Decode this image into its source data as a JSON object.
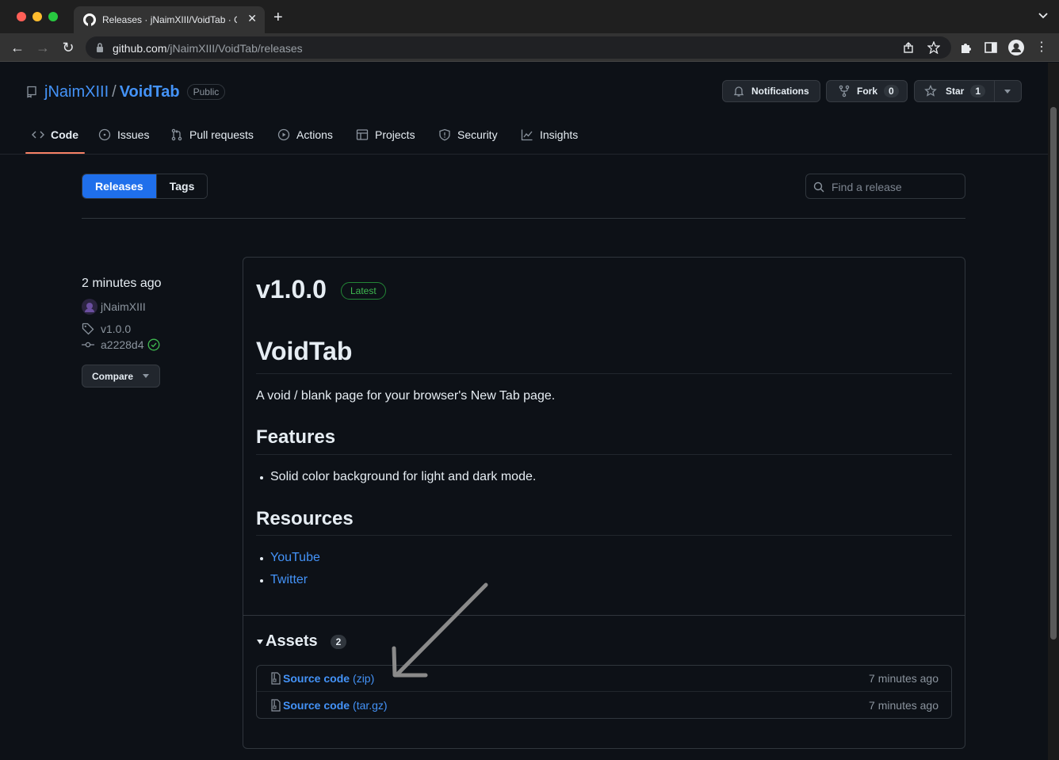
{
  "browser": {
    "tab_title": "Releases · jNaimXIII/VoidTab · GitHub",
    "url_domain": "github.com",
    "url_path": "/jNaimXIII/VoidTab/releases"
  },
  "repo": {
    "owner": "jNaimXIII",
    "separator": "/",
    "name": "VoidTab",
    "visibility": "Public",
    "notifications_label": "Notifications",
    "fork_label": "Fork",
    "fork_count": "0",
    "star_label": "Star",
    "star_count": "1"
  },
  "nav": {
    "items": [
      {
        "label": "Code",
        "icon": "code-icon"
      },
      {
        "label": "Issues",
        "icon": "issue-icon"
      },
      {
        "label": "Pull requests",
        "icon": "pull-request-icon"
      },
      {
        "label": "Actions",
        "icon": "play-icon"
      },
      {
        "label": "Projects",
        "icon": "table-icon"
      },
      {
        "label": "Security",
        "icon": "shield-icon"
      },
      {
        "label": "Insights",
        "icon": "graph-icon"
      }
    ],
    "active": "Code"
  },
  "subnav": {
    "releases_label": "Releases",
    "tags_label": "Tags",
    "search_placeholder": "Find a release"
  },
  "release": {
    "time": "2 minutes ago",
    "author": "jNaimXIII",
    "tag": "v1.0.0",
    "commit": "a2228d4",
    "compare_label": "Compare",
    "version": "v1.0.0",
    "latest_label": "Latest",
    "heading": "VoidTab",
    "description": "A void / blank page for your browser's New Tab page.",
    "features_heading": "Features",
    "features": [
      "Solid color background for light and dark mode."
    ],
    "resources_heading": "Resources",
    "resources": [
      "YouTube",
      "Twitter"
    ],
    "assets_heading": "Assets",
    "assets_count": "2",
    "assets": [
      {
        "name": "Source code",
        "ext": "(zip)",
        "time": "7 minutes ago"
      },
      {
        "name": "Source code",
        "ext": "(tar.gz)",
        "time": "7 minutes ago"
      }
    ]
  },
  "colors": {
    "accent": "#1f6feb",
    "link": "#4493f8",
    "latest": "#3fb950",
    "tab_underline": "#f78166"
  }
}
